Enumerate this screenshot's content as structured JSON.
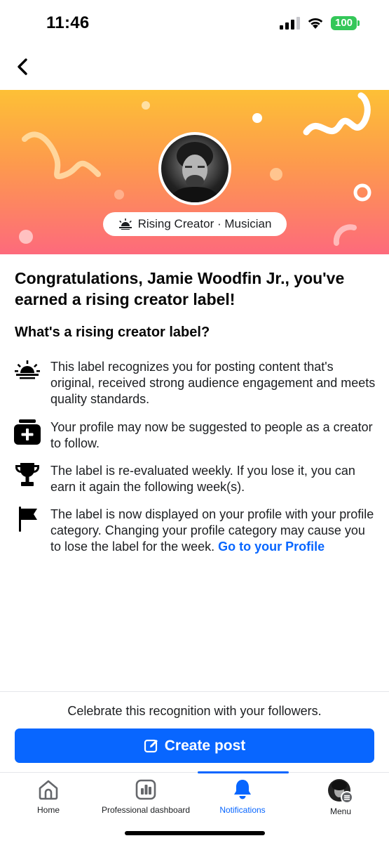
{
  "status": {
    "time": "11:46",
    "battery": "100"
  },
  "banner": {
    "pill_text": "Rising Creator · Musician"
  },
  "content": {
    "heading": "Congratulations, Jamie Woodfin Jr., you've earned a rising creator label!",
    "subheading": "What's a rising creator label?",
    "items": [
      {
        "icon": "sunrise-icon",
        "text": "This label recognizes you for posting content that's original, received strong audience engagement and meets quality standards."
      },
      {
        "icon": "add-follow-icon",
        "text": "Your profile may now be suggested to people as a creator to follow."
      },
      {
        "icon": "trophy-icon",
        "text": "The label is re-evaluated weekly. If you lose it, you can earn it again the following week(s)."
      },
      {
        "icon": "flag-icon",
        "text": "The label is now displayed on your profile with your profile category. Changing your profile category may cause you to lose the label for the week.",
        "link": "Go to your Profile"
      }
    ]
  },
  "action": {
    "celebrate": "Celebrate this recognition with your followers.",
    "button": "Create post"
  },
  "tabs": [
    {
      "label": "Home",
      "icon": "home-icon"
    },
    {
      "label": "Professional dashboard",
      "icon": "dashboard-icon"
    },
    {
      "label": "Notifications",
      "icon": "bell-icon",
      "active": true
    },
    {
      "label": "Menu",
      "icon": "profile-avatar-icon"
    }
  ],
  "colors": {
    "accent": "#0866ff",
    "banner_top": "#fdc036",
    "banner_bottom": "#fd6a7c"
  }
}
